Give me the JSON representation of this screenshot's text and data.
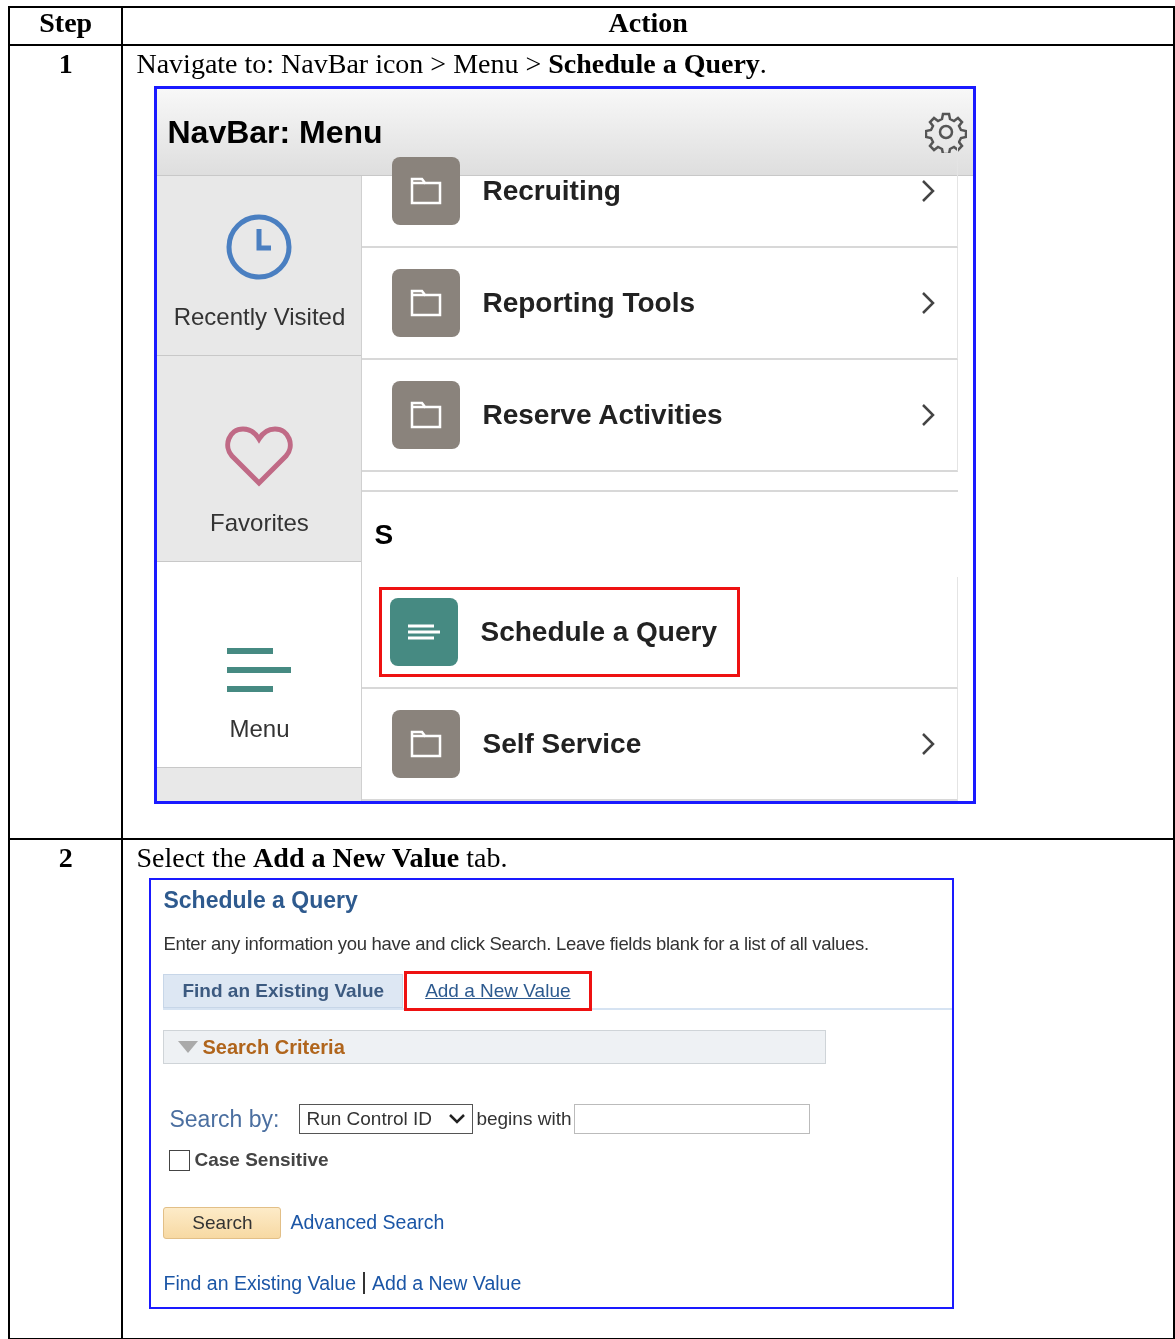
{
  "table": {
    "columns": [
      "Step",
      "Action"
    ],
    "rows": [
      {
        "step": "1",
        "instruction": "Navigate to: NavBar icon > Menu > **Schedule a Query**.",
        "screenshot": {
          "kind": "navbar",
          "title": "NavBar: Menu",
          "sidebar": [
            {
              "label": "Recently Visited",
              "kind": "clock",
              "selected": false
            },
            {
              "label": "Favorites",
              "kind": "heart",
              "selected": false
            },
            {
              "label": "Menu",
              "kind": "menu",
              "selected": true
            }
          ],
          "entries": [
            {
              "kind": "folder",
              "label": "Recruiting",
              "highlighted": false
            },
            {
              "kind": "folder",
              "label": "Reporting Tools",
              "highlighted": false
            },
            {
              "kind": "folder",
              "label": "Reserve Activities",
              "highlighted": false
            },
            {
              "kind": "section",
              "label": "S"
            },
            {
              "kind": "component",
              "label": "Schedule a Query",
              "highlighted": true
            },
            {
              "kind": "folder",
              "label": "Self Service",
              "highlighted": false
            }
          ]
        }
      },
      {
        "step": "2",
        "instruction": "Select the **Add a New Value** tab.",
        "screenshot": {
          "kind": "search_page",
          "title": "Schedule a Query",
          "instructions": "Enter any information you have and click Search. Leave fields blank for a list of all values.",
          "tabs": [
            {
              "label": "Find an Existing Value",
              "selected": true,
              "highlighted": false
            },
            {
              "label": "Add a New Value",
              "selected": false,
              "highlighted": true
            }
          ],
          "section": {
            "label": "Search Criteria",
            "expanded": true
          },
          "search_by": {
            "label": "Search by:",
            "select_value": "Run Control ID",
            "operator": "begins with"
          },
          "case_sensitive": {
            "label": "Case Sensitive",
            "checked": false
          },
          "search_button": "Search",
          "advanced_link": "Advanced Search",
          "footer_links": [
            "Find an Existing Value",
            "Add a New Value"
          ]
        }
      }
    ]
  }
}
